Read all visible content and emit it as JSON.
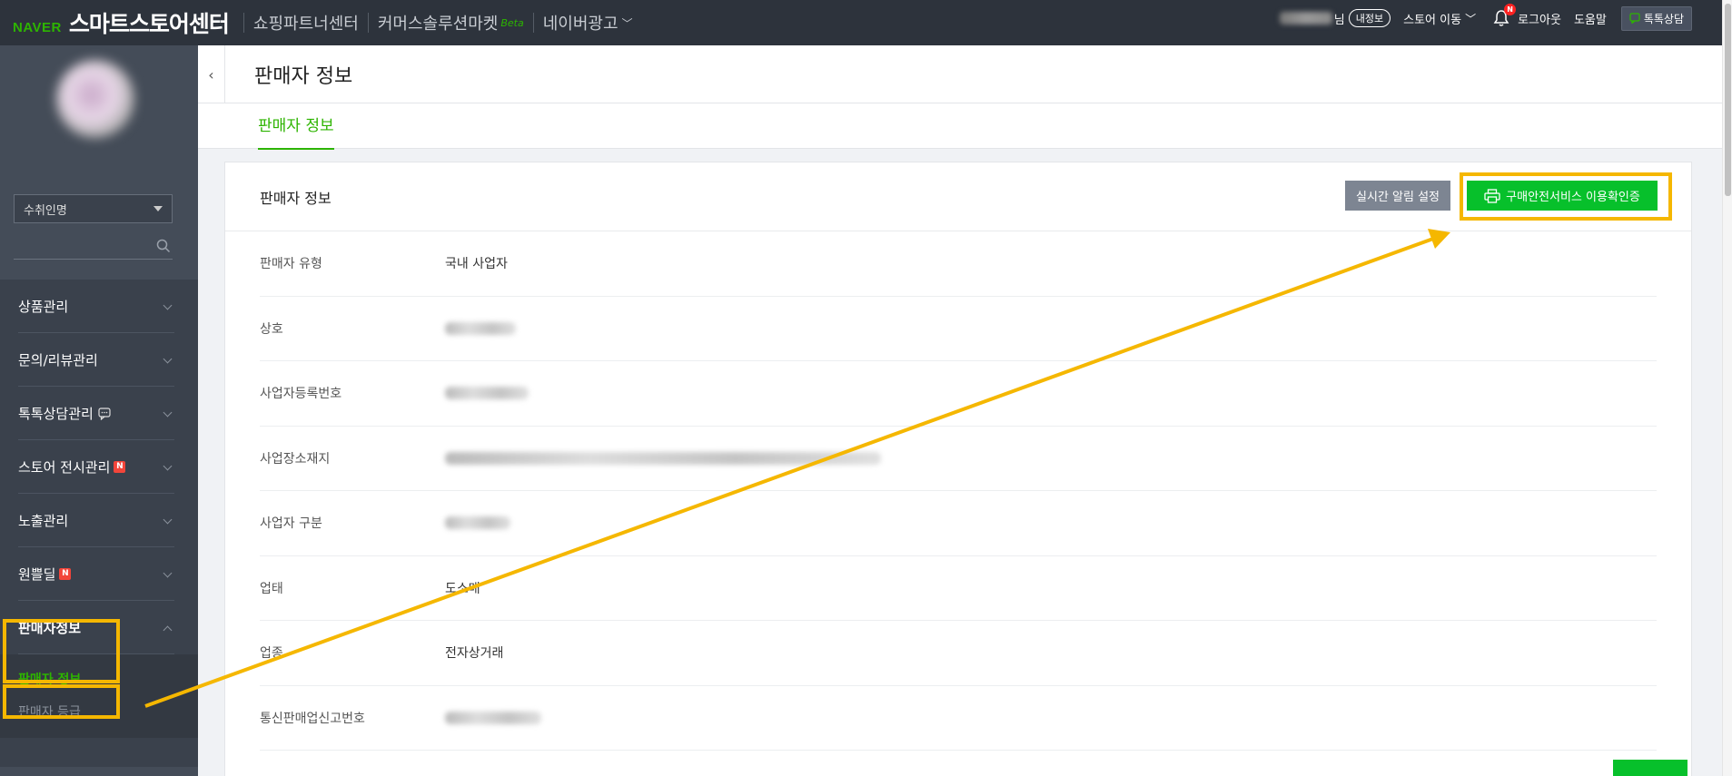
{
  "topbar": {
    "logo": "NAVER",
    "title": "스마트스토어센터",
    "nav": [
      {
        "label": "쇼핑파트너센터"
      },
      {
        "label": "커머스솔루션마켓",
        "badge": "Beta"
      },
      {
        "label": "네이버광고"
      }
    ],
    "user_suffix": "님",
    "my_info": "내정보",
    "store_move": "스토어 이동",
    "notification_badge": "N",
    "logout": "로그아웃",
    "help": "도움말",
    "talk": "톡톡상담"
  },
  "sidebar": {
    "store_name": "수취인명",
    "menu": [
      {
        "label": "상품관리"
      },
      {
        "label": "문의/리뷰관리"
      },
      {
        "label": "톡톡상담관리"
      },
      {
        "label": "스토어 전시관리",
        "badge": "N"
      },
      {
        "label": "노출관리"
      },
      {
        "label": "원쁠딜",
        "badge": "N"
      },
      {
        "label": "판매자정보"
      }
    ],
    "submenu": [
      "판매자 정보",
      "판매자 등급"
    ]
  },
  "header": {
    "collapse_glyph": "‹",
    "title": "판매자 정보",
    "tab": "판매자 정보"
  },
  "card": {
    "title": "판매자 정보",
    "alarm_button": "실시간 알림 설정",
    "cert_button": "구매안전서비스 이용확인증",
    "rows": [
      {
        "label": "판매자 유형",
        "value": "국내 사업자"
      },
      {
        "label": "상호",
        "value": ""
      },
      {
        "label": "사업자등록번호",
        "value": ""
      },
      {
        "label": "사업장소재지",
        "value": ""
      },
      {
        "label": "사업자 구분",
        "value": ""
      },
      {
        "label": "업태",
        "value": "도소매"
      },
      {
        "label": "업종",
        "value": "전자상거래"
      },
      {
        "label": "통신판매업신고번호",
        "value": ""
      }
    ]
  },
  "colors": {
    "topbar_bg": "#2d333c",
    "sidebar_bg": "#3a414c",
    "accent_green": "#2db400",
    "cert_button": "#07c02b",
    "highlight": "#f5b700"
  }
}
